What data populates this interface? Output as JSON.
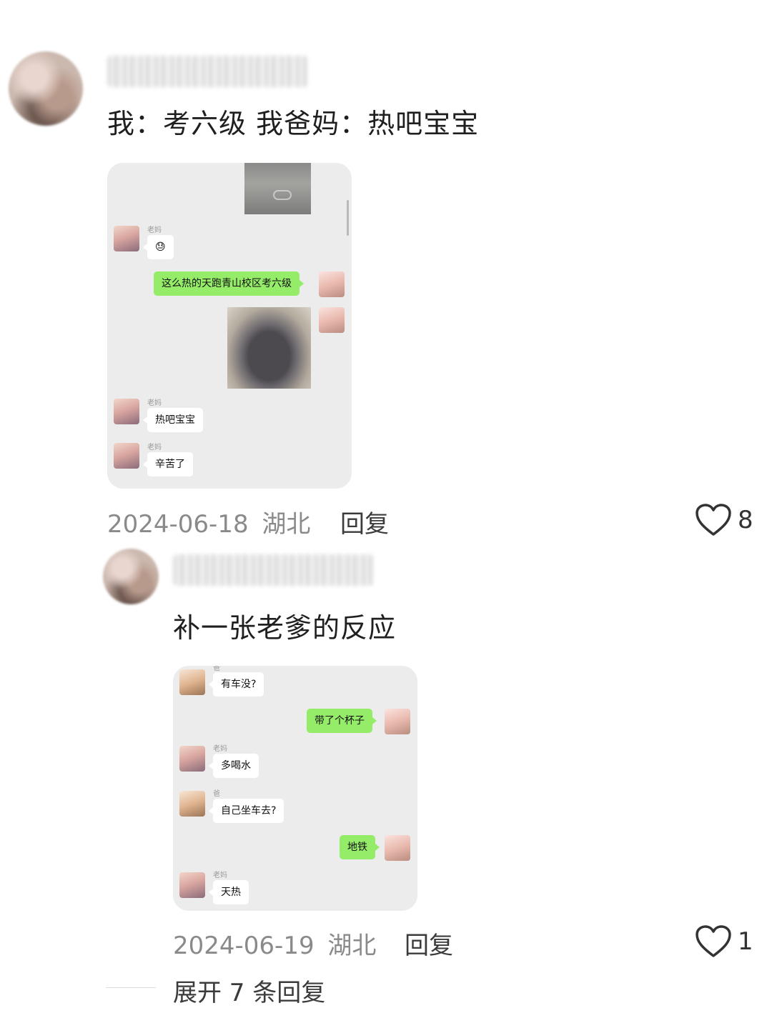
{
  "comments": [
    {
      "text": "我：考六级 我爸妈：热吧宝宝",
      "date": "2024-06-18",
      "location": "湖北",
      "reply_label": "回复",
      "like_count": "8",
      "chat": {
        "label_mom": "老妈",
        "my_message": "这么热的天跑青山校区考六级",
        "mom_reply_1": "热吧宝宝",
        "mom_reply_2": "辛苦了",
        "emoji": "😓"
      }
    },
    {
      "text": "补一张老爹的反应",
      "date": "2024-06-19",
      "location": "湖北",
      "reply_label": "回复",
      "like_count": "1",
      "chat": {
        "label_dad": "爸",
        "label_mom": "老妈",
        "dad_msg_1": "有车没?",
        "me_msg_1": "带了个杯子",
        "mom_msg_1": "多喝水",
        "dad_msg_2": "自己坐车去?",
        "me_msg_2": "地铁",
        "mom_msg_2": "天热"
      }
    }
  ],
  "expand_replies": "展开 7 条回复",
  "icons": {
    "like": "heart-outline-icon"
  }
}
